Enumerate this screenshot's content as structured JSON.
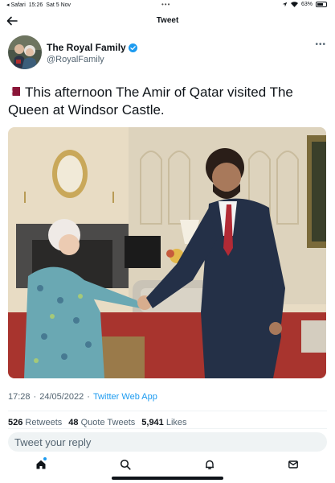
{
  "status_bar": {
    "carrier": "◂ Safari",
    "time": "15:26",
    "date": "Sat 5 Nov",
    "battery_text": "63%"
  },
  "nav": {
    "title": "Tweet",
    "back_icon": "arrow-left-icon"
  },
  "author": {
    "name": "The Royal Family",
    "handle": "@RoyalFamily",
    "verified_icon": "verified-badge-icon",
    "more_icon": "more-dots-icon"
  },
  "tweet": {
    "flag_icon": "qatar-flag-icon",
    "text": "This afternoon The Amir of Qatar visited The Queen at Windsor Castle."
  },
  "meta": {
    "time": "17:28",
    "date": "24/05/2022",
    "separator": "·",
    "client": "Twitter Web App"
  },
  "stats": {
    "retweets_count": "526",
    "retweets_label": "Retweets",
    "quotes_count": "48",
    "quotes_label": "Quote Tweets",
    "likes_count": "5,941",
    "likes_label": "Likes"
  },
  "reply": {
    "placeholder": "Tweet your reply"
  },
  "tab_bar": {
    "icons": [
      "home-icon",
      "search-icon",
      "notifications-icon",
      "messages-icon"
    ]
  },
  "colors": {
    "accent": "#1d9bf0",
    "text": "#0f1419",
    "secondary": "#536471",
    "divider": "#eff3f4"
  }
}
